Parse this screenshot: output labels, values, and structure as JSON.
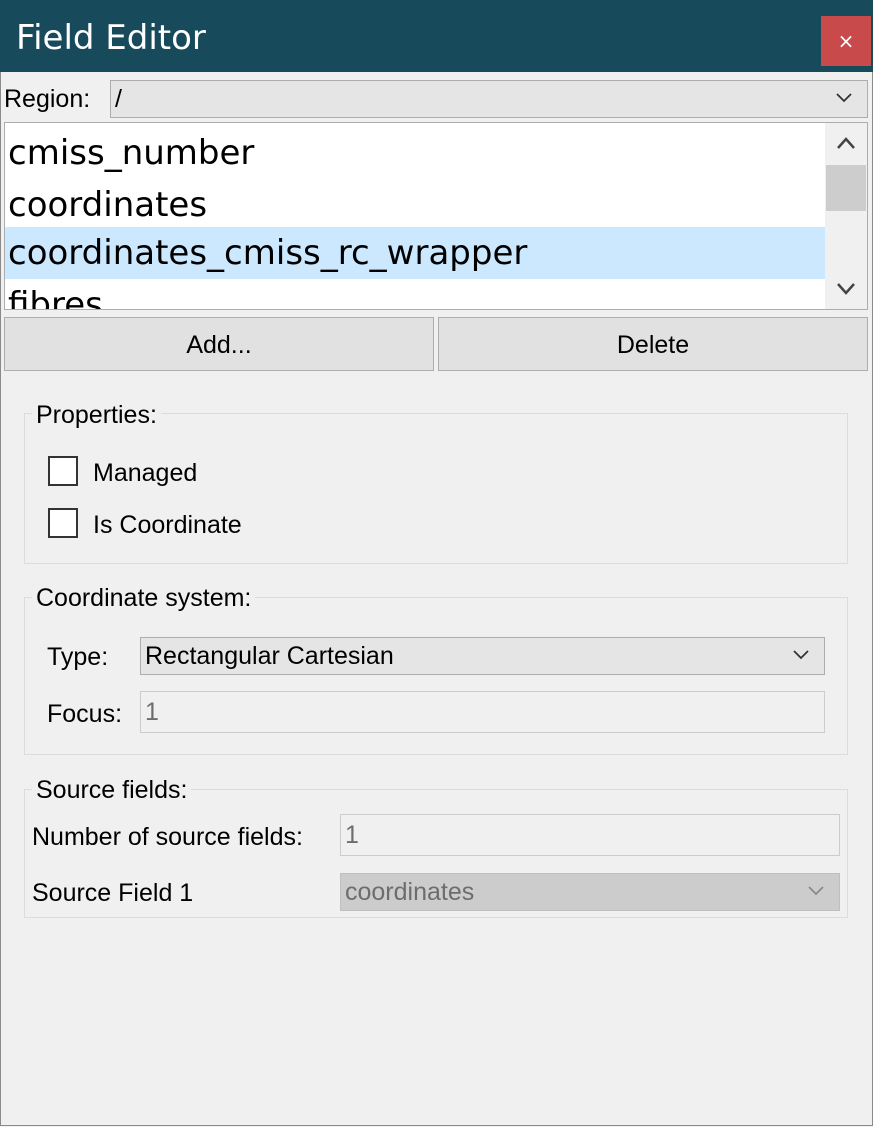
{
  "window": {
    "title": "Field Editor",
    "close_symbol": "×",
    "accent_color": "#174a5b",
    "close_color": "#c94a4a"
  },
  "region": {
    "label": "Region:",
    "value": "/"
  },
  "field_list": {
    "items": [
      {
        "label": "cmiss_number",
        "selected": false
      },
      {
        "label": "coordinates",
        "selected": false
      },
      {
        "label": "coordinates_cmiss_rc_wrapper",
        "selected": true
      },
      {
        "label": "fibres",
        "selected": false
      }
    ]
  },
  "buttons": {
    "add_label": "Add...",
    "delete_label": "Delete"
  },
  "properties": {
    "title": "Properties:",
    "managed_label": "Managed",
    "managed_checked": false,
    "is_coordinate_label": "Is Coordinate",
    "is_coordinate_checked": false
  },
  "coordinate_system": {
    "title": "Coordinate system:",
    "type_label": "Type:",
    "type_value": "Rectangular Cartesian",
    "focus_label": "Focus:",
    "focus_value": "1"
  },
  "source_fields": {
    "title": "Source fields:",
    "count_label": "Number of source fields:",
    "count_value": "1",
    "field1_label": "Source Field 1",
    "field1_value": "coordinates"
  },
  "icons": {
    "close": "close-icon",
    "dropdown": "chevron-down-icon",
    "scroll_up": "chevron-up-icon",
    "scroll_down": "chevron-down-icon"
  }
}
